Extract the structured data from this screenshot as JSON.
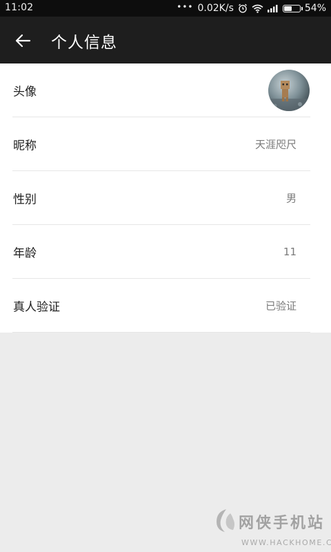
{
  "status_bar": {
    "time": "11:02",
    "net_speed": "0.02K/s",
    "battery_percent": "54%",
    "battery_level": 0.54,
    "icons": [
      "more-dots-icon",
      "alarm-icon",
      "wifi-icon",
      "signal-icon",
      "battery-icon"
    ]
  },
  "header": {
    "back_icon": "arrow-left-icon",
    "title": "个人信息"
  },
  "profile": {
    "rows": [
      {
        "label": "头像",
        "value": ""
      },
      {
        "label": "昵称",
        "value": "天涯咫尺"
      },
      {
        "label": "性别",
        "value": "男"
      },
      {
        "label": "年龄",
        "value": "11"
      },
      {
        "label": "真人验证",
        "value": "已验证"
      }
    ]
  },
  "watermark": {
    "name": "网侠手机站",
    "url": "WWW.HACKHOME.COM"
  },
  "colors": {
    "status_bar_bg": "#0d0d0d",
    "title_bar_bg": "#1e1e1e",
    "page_bg": "#ececec",
    "card_bg": "#ffffff",
    "divider": "#e6e6e6",
    "label_text": "#222222",
    "value_text": "#7a7a7a"
  }
}
